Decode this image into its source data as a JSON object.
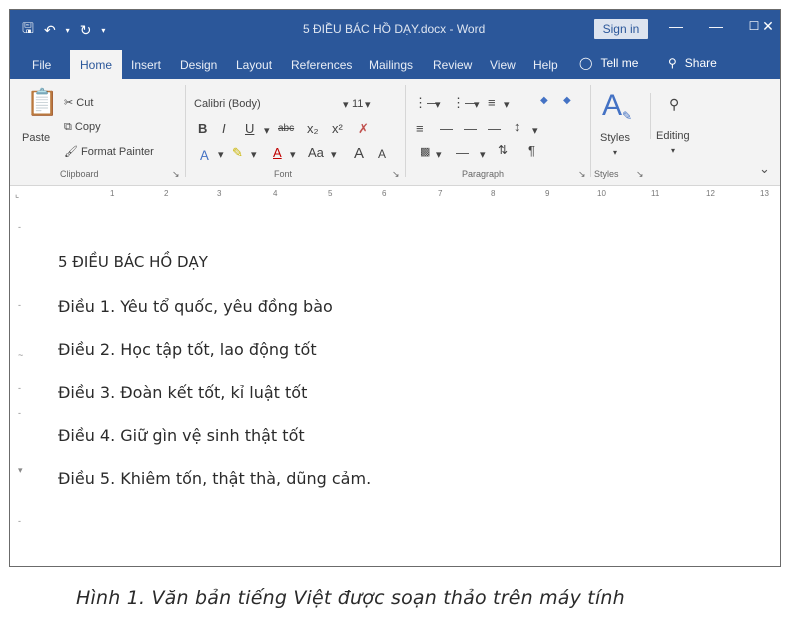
{
  "window": {
    "title": "5 ĐIỀU BÁC HỒ DẠY.docx - Word",
    "signin_label": "Sign in",
    "qat_icons": [
      "save-icon",
      "undo-icon",
      "redo-icon",
      "customize-icon"
    ],
    "window_controls": [
      "ribbon-options-icon",
      "minimize-icon",
      "maximize-icon",
      "close-icon"
    ]
  },
  "tabs": {
    "file": "File",
    "home": "Home",
    "insert": "Insert",
    "design": "Design",
    "layout": "Layout",
    "references": "References",
    "mailings": "Mailings",
    "review": "Review",
    "view": "View",
    "help": "Help",
    "tellme": "Tell me",
    "share": "Share"
  },
  "ribbon": {
    "clipboard": {
      "paste": "Paste",
      "cut": "Cut",
      "copy": "Copy",
      "format_painter": "Format Painter",
      "label": "Clipboard"
    },
    "font": {
      "name": "Calibri (Body)",
      "size": "11",
      "label": "Font",
      "bold": "B",
      "italic": "I",
      "underline": "U",
      "strikethrough": "abc",
      "subscript": "x₂",
      "superscript": "x²",
      "change_case": "Aa",
      "grow": "A",
      "shrink": "A"
    },
    "paragraph": {
      "label": "Paragraph",
      "show_marks": "¶"
    },
    "styles": {
      "label": "Styles",
      "button": "Styles"
    },
    "editing": {
      "label": "Editing"
    }
  },
  "ruler": {
    "numbers": [
      "1",
      "2",
      "3",
      "4",
      "5",
      "6",
      "7",
      "8",
      "9",
      "10",
      "11",
      "12",
      "13"
    ]
  },
  "document": {
    "lines": [
      "5 ĐIỀU BÁC HỒ DẠY",
      "Điều 1. Yêu tổ quốc, yêu đồng bào",
      "Điều 2. Học tập tốt, lao động tốt",
      "Điều 3. Đoàn kết tốt, kỉ luật tốt",
      "Điều 4. Giữ gìn vệ sinh thật tốt",
      "Điều 5.  Khiêm tốn, thật thà, dũng cảm."
    ]
  },
  "caption": "Hình 1. Văn bản tiếng Việt được soạn thảo trên máy tính"
}
